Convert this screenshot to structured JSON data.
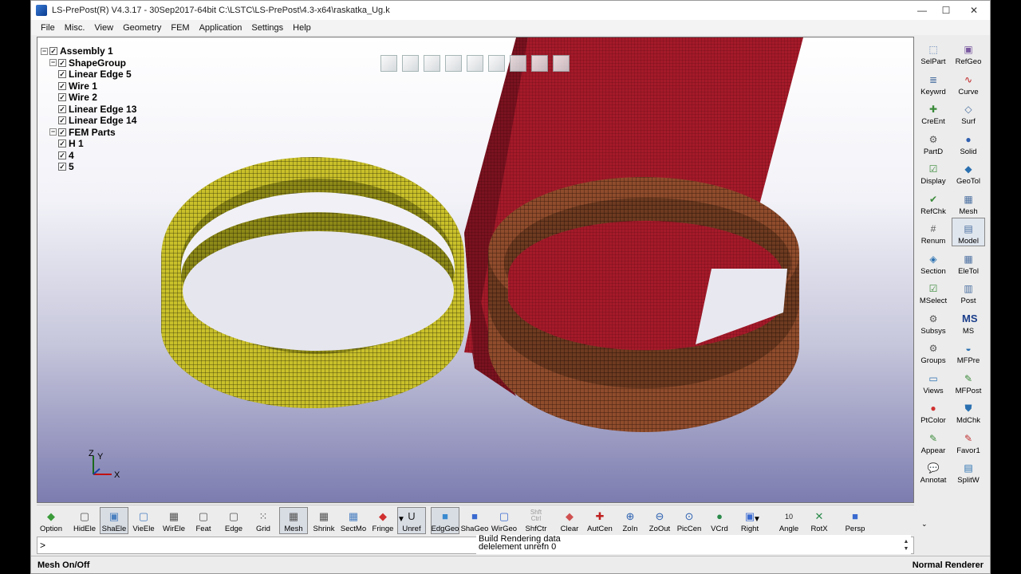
{
  "titlebar": {
    "title": "LS-PrePost(R) V4.3.17 - 30Sep2017-64bit C:\\LSTC\\LS-PrePost\\4.3-x64\\raskatka_Ug.k",
    "minimize": "—",
    "maximize": "☐",
    "close": "✕"
  },
  "menu": [
    "File",
    "Misc.",
    "View",
    "Geometry",
    "FEM",
    "Application",
    "Settings",
    "Help"
  ],
  "tree": [
    {
      "label": "Assembly 1",
      "level": 0,
      "expander": false
    },
    {
      "label": "ShapeGroup",
      "level": 1,
      "expander": true
    },
    {
      "label": "Linear Edge 5",
      "level": 2,
      "expander": false
    },
    {
      "label": "Wire 1",
      "level": 2,
      "expander": false
    },
    {
      "label": "Wire 2",
      "level": 2,
      "expander": false
    },
    {
      "label": "Linear Edge 13",
      "level": 2,
      "expander": false
    },
    {
      "label": "Linear Edge 14",
      "level": 2,
      "expander": false
    },
    {
      "label": "FEM Parts",
      "level": 1,
      "expander": true
    },
    {
      "label": "H 1",
      "level": 2,
      "expander": false
    },
    {
      "label": "4",
      "level": 2,
      "expander": false
    },
    {
      "label": "5",
      "level": 2,
      "expander": false
    }
  ],
  "axis": {
    "z": "Z",
    "y": "Y",
    "x": "X"
  },
  "right_panel": [
    {
      "label": "SelPart",
      "icon": "select-part-icon",
      "glyph": "⬚",
      "color": "#5a7fb5"
    },
    {
      "label": "RefGeo",
      "icon": "refgeo-icon",
      "glyph": "▣",
      "color": "#7a5aa0"
    },
    {
      "label": "Keywrd",
      "icon": "keyword-icon",
      "glyph": "≣",
      "color": "#4a6fa0"
    },
    {
      "label": "Curve",
      "icon": "curve-icon",
      "glyph": "∿",
      "color": "#c02020"
    },
    {
      "label": "CreEnt",
      "icon": "create-entity-icon",
      "glyph": "✚",
      "color": "#3a8a3a"
    },
    {
      "label": "Surf",
      "icon": "surface-icon",
      "glyph": "◇",
      "color": "#4a6fa0"
    },
    {
      "label": "PartD",
      "icon": "part-data-icon",
      "glyph": "⚙",
      "color": "#555"
    },
    {
      "label": "Solid",
      "icon": "solid-icon",
      "glyph": "●",
      "color": "#2f5fb0"
    },
    {
      "label": "Display",
      "icon": "display-icon",
      "glyph": "☑",
      "color": "#3a8a3a"
    },
    {
      "label": "GeoTol",
      "icon": "geotol-icon",
      "glyph": "◆",
      "color": "#2a70b0"
    },
    {
      "label": "RefChk",
      "icon": "refcheck-icon",
      "glyph": "✔",
      "color": "#3a8a3a"
    },
    {
      "label": "Mesh",
      "icon": "mesh-icon",
      "glyph": "▦",
      "color": "#4a6fa0"
    },
    {
      "label": "Renum",
      "icon": "renumber-icon",
      "glyph": "#",
      "color": "#555"
    },
    {
      "label": "Model",
      "icon": "model-icon",
      "glyph": "▤",
      "color": "#4a6fa0"
    },
    {
      "label": "Section",
      "icon": "section-icon",
      "glyph": "◈",
      "color": "#2a70b0"
    },
    {
      "label": "EleTol",
      "icon": "eletol-icon",
      "glyph": "▦",
      "color": "#4a6fa0"
    },
    {
      "label": "MSelect",
      "icon": "multi-select-icon",
      "glyph": "☑",
      "color": "#3a8a3a"
    },
    {
      "label": "Post",
      "icon": "post-icon",
      "glyph": "▥",
      "color": "#4a6fa0"
    },
    {
      "label": "Subsys",
      "icon": "subsystem-icon",
      "glyph": "⚙",
      "color": "#555"
    },
    {
      "label": "MS",
      "icon": "ms-icon",
      "glyph": "MS",
      "color": "#1a3d8a"
    },
    {
      "label": "Groups",
      "icon": "groups-icon",
      "glyph": "⚙",
      "color": "#555"
    },
    {
      "label": "MFPre",
      "icon": "mfpre-icon",
      "glyph": "◒",
      "color": "#2a70b0"
    },
    {
      "label": "Views",
      "icon": "views-icon",
      "glyph": "▭",
      "color": "#2a70b0"
    },
    {
      "label": "MFPost",
      "icon": "mfpost-icon",
      "glyph": "✎",
      "color": "#3a8a3a"
    },
    {
      "label": "PtColor",
      "icon": "part-color-icon",
      "glyph": "●",
      "color": "#d03030"
    },
    {
      "label": "MdChk",
      "icon": "model-check-icon",
      "glyph": "⛊",
      "color": "#2a70b0"
    },
    {
      "label": "Appear",
      "icon": "appearance-icon",
      "glyph": "✎",
      "color": "#3a8a3a"
    },
    {
      "label": "Favor1",
      "icon": "favorite-icon",
      "glyph": "✎",
      "color": "#c03030"
    },
    {
      "label": "Annotat",
      "icon": "annotate-icon",
      "glyph": "💬",
      "color": "#c0a020"
    },
    {
      "label": "SplitW",
      "icon": "split-window-icon",
      "glyph": "▤",
      "color": "#2a70b0"
    }
  ],
  "toolbar": [
    {
      "label": "Option",
      "icon": "option-icon",
      "glyph": "◆",
      "color": "#3a9a3a"
    },
    {
      "label": "HidEle",
      "icon": "hide-element-icon",
      "glyph": "▢",
      "color": "#555"
    },
    {
      "label": "ShaEle",
      "icon": "shade-element-icon",
      "glyph": "▣",
      "color": "#4a7fc0"
    },
    {
      "label": "VieEle",
      "icon": "view-element-icon",
      "glyph": "▢",
      "color": "#4a7fc0"
    },
    {
      "label": "WirEle",
      "icon": "wire-element-icon",
      "glyph": "▦",
      "color": "#555"
    },
    {
      "label": "Feat",
      "icon": "feature-icon",
      "glyph": "▢",
      "color": "#555"
    },
    {
      "label": "Edge",
      "icon": "edge-icon",
      "glyph": "▢",
      "color": "#555"
    },
    {
      "label": "Grid",
      "icon": "grid-icon",
      "glyph": "⁙",
      "color": "#555"
    },
    {
      "label": "Mesh",
      "icon": "mesh-toggle-icon",
      "glyph": "▦",
      "color": "#555"
    },
    {
      "label": "Shrink",
      "icon": "shrink-icon",
      "glyph": "▦",
      "color": "#555"
    },
    {
      "label": "SectMo",
      "icon": "section-mode-icon",
      "glyph": "▦",
      "color": "#4a7fc0"
    },
    {
      "label": "Fringe",
      "icon": "fringe-icon",
      "glyph": "◆",
      "color": "#d03030"
    },
    {
      "label": "Unref",
      "icon": "unref-icon",
      "glyph": "U",
      "color": "#222"
    },
    {
      "label": "EdgGeo",
      "icon": "edge-geometry-icon",
      "glyph": "■",
      "color": "#3a8ad0"
    },
    {
      "label": "ShaGeo",
      "icon": "shade-geometry-icon",
      "glyph": "■",
      "color": "#3a6ad0"
    },
    {
      "label": "WirGeo",
      "icon": "wire-geometry-icon",
      "glyph": "▢",
      "color": "#3a6ad0"
    },
    {
      "label": "ShfCtr",
      "icon": "shift-ctrl-icon",
      "glyph": "Shft Ctrl",
      "color": "#999"
    },
    {
      "label": "Clear",
      "icon": "clear-icon",
      "glyph": "◆",
      "color": "#d05050"
    },
    {
      "label": "AutCen",
      "icon": "auto-center-icon",
      "glyph": "✚",
      "color": "#c02020"
    },
    {
      "label": "ZoIn",
      "icon": "zoom-in-icon",
      "glyph": "⊕",
      "color": "#2a5fb0"
    },
    {
      "label": "ZoOut",
      "icon": "zoom-out-icon",
      "glyph": "⊖",
      "color": "#2a5fb0"
    },
    {
      "label": "PicCen",
      "icon": "pick-center-icon",
      "glyph": "⊙",
      "color": "#2a5fb0"
    },
    {
      "label": "VCrd",
      "icon": "view-coord-icon",
      "glyph": "●",
      "color": "#2a8a4a"
    },
    {
      "label": "Right",
      "icon": "right-view-icon",
      "glyph": "▣",
      "color": "#3a6ad0"
    },
    {
      "label": "Angle",
      "icon": "angle-icon",
      "glyph": "10",
      "color": "#222"
    },
    {
      "label": "RotX",
      "icon": "rotate-x-icon",
      "glyph": "✕",
      "color": "#2a8a4a"
    },
    {
      "label": "Persp",
      "icon": "perspective-icon",
      "glyph": "■",
      "color": "#3a6ad0"
    }
  ],
  "command": {
    "prompt": ">",
    "messages": [
      "Build Rendering data",
      "delelement unrefn 0"
    ]
  },
  "status": {
    "left": "Mesh On/Off",
    "right": "Normal Renderer"
  },
  "colors": {
    "ring_left": "#c9c02a",
    "ring_right": "#8a4a2a",
    "plate": "#a01a28"
  }
}
